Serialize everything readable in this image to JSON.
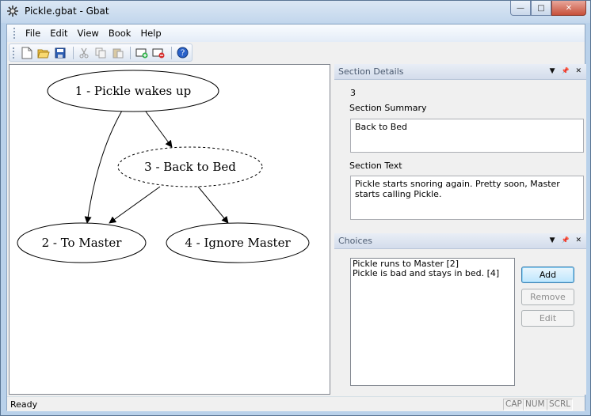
{
  "window": {
    "title": "Pickle.gbat - Gbat",
    "icon": "gbat-app-icon"
  },
  "caption_buttons": {
    "minimize": "—",
    "maximize": "□",
    "close": "✕"
  },
  "menu": [
    {
      "label": "File"
    },
    {
      "label": "Edit"
    },
    {
      "label": "View"
    },
    {
      "label": "Book"
    },
    {
      "label": "Help"
    }
  ],
  "toolbar": {
    "icons": [
      "new-icon",
      "open-icon",
      "save-icon",
      "cut-icon",
      "copy-icon",
      "paste-icon",
      "add-section-icon",
      "delete-section-icon",
      "help-icon"
    ]
  },
  "graph": {
    "nodes": [
      {
        "id": "1",
        "label": "1 - Pickle wakes up",
        "selected": false
      },
      {
        "id": "3",
        "label": "3 - Back to Bed",
        "selected": true
      },
      {
        "id": "2",
        "label": "2 - To Master",
        "selected": false
      },
      {
        "id": "4",
        "label": "4 - Ignore Master",
        "selected": false
      }
    ],
    "edges": [
      {
        "from": "1",
        "to": "3"
      },
      {
        "from": "1",
        "to": "2"
      },
      {
        "from": "3",
        "to": "2"
      },
      {
        "from": "3",
        "to": "4"
      }
    ]
  },
  "section_details": {
    "header": "Section Details",
    "number": "3",
    "summary_label": "Section Summary",
    "summary_value": "Back to Bed",
    "text_label": "Section Text",
    "text_value": "Pickle starts snoring again.  Pretty soon, Master starts calling Pickle."
  },
  "choices": {
    "header": "Choices",
    "items": [
      "Pickle runs to Master [2]",
      "Pickle is bad and stays in bed. [4]"
    ],
    "add_label": "Add",
    "remove_label": "Remove",
    "edit_label": "Edit"
  },
  "panel_buttons": {
    "dropdown": "▼",
    "pin": "📌",
    "close": "✕"
  },
  "status": {
    "text": "Ready",
    "cap": "CAP",
    "num": "NUM",
    "scrl": "SCRL"
  }
}
